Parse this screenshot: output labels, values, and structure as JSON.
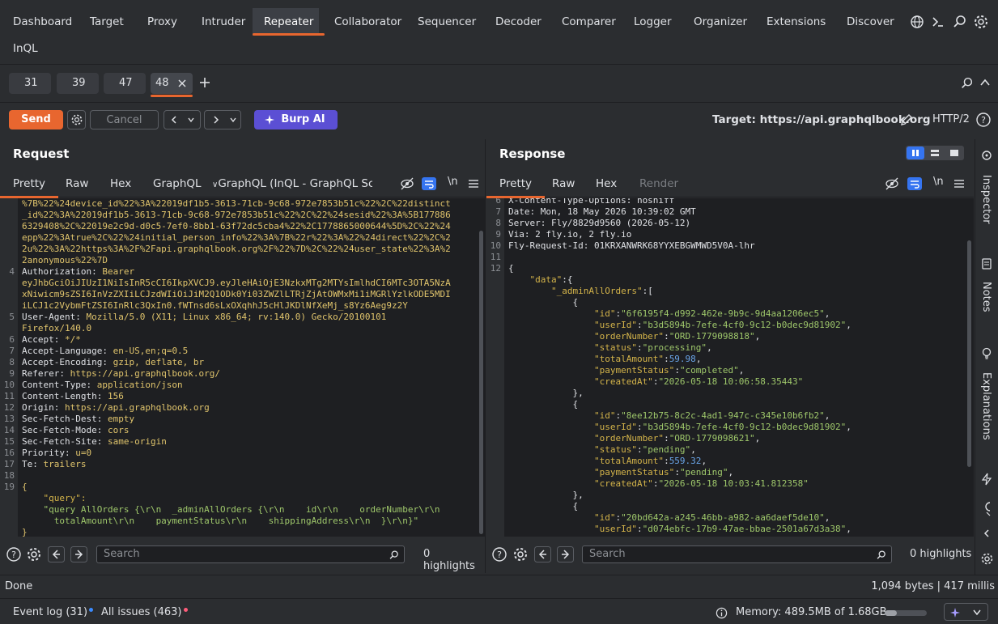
{
  "nav": {
    "tabs": [
      "Dashboard",
      "Target",
      "Proxy",
      "Intruder",
      "Repeater",
      "Collaborator",
      "Sequencer",
      "Decoder",
      "Comparer",
      "Logger",
      "Organizer",
      "Extensions",
      "Discover"
    ],
    "second_row": "InQL"
  },
  "repeater_tabs": [
    "31",
    "39",
    "47",
    "48"
  ],
  "toolbar": {
    "send": "Send",
    "cancel": "Cancel",
    "burp_ai": "Burp AI",
    "target": "Target: https://api.graphqlbook.org",
    "protocol": "HTTP/2"
  },
  "request": {
    "title": "Request",
    "tabs": [
      "Pretty",
      "Raw",
      "Hex",
      "GraphQL",
      "GraphQL (InQL - GraphQL Sc..."
    ],
    "newline_toggle": "\\n",
    "lines": [
      {
        "n": "",
        "t": "%7B%22%24device_id%22%3A%22019df1b5-3613-71cb-9c68-972e7853b51c%22%2C%22distinct"
      },
      {
        "n": "",
        "t": "_id%22%3A%22019df1b5-3613-71cb-9c68-972e7853b51c%22%2C%22%24sesid%22%3A%5B177886"
      },
      {
        "n": "",
        "t": "6329408%2C%22019e2c9d-d0c5-7ef0-8bb1-63f72dc5cba4%22%2C1778865000644%5D%2C%22%24"
      },
      {
        "n": "",
        "t": "epp%22%3Atrue%2C%22%24initial_person_info%22%3A%7B%22r%22%3A%22%24direct%22%2C%2"
      },
      {
        "n": "",
        "t": "2u%22%3A%22https%3A%2F%2Fapi.graphqlbook.org%2F%22%7D%2C%22%24user_state%22%3A%2"
      },
      {
        "n": "",
        "t": "2anonymous%22%7D"
      },
      {
        "n": "4",
        "k": "Authorization:",
        "v": " Bearer"
      },
      {
        "n": "",
        "v": "eyJhbGciOiJIUzI1NiIsInR5cCI6IkpXVCJ9.eyJleHAiOjE3NzkxMTg2MTYsImlhdCI6MTc3OTA5NzA"
      },
      {
        "n": "",
        "v": "xNiwicm9sZSI6InVzZXIiLCJzdWIiOiJiM2Q1ODk0Yi03ZWZlLTRjZjAtOWMxMi1iMGRlYzlkODE5MDI"
      },
      {
        "n": "",
        "v": "iLCJ1c2VybmFtZSI6InRlc3QxIn0.fWTnsd6sLxOXqhhJ5cHlJKDlNfXeMj_s8Yz6Aeg9z2Y"
      },
      {
        "n": "5",
        "k": "User-Agent:",
        "v": " Mozilla/5.0 (X11; Linux x86_64; rv:140.0) Gecko/20100101"
      },
      {
        "n": "",
        "v": "Firefox/140.0"
      },
      {
        "n": "6",
        "k": "Accept:",
        "v": " */*"
      },
      {
        "n": "7",
        "k": "Accept-Language:",
        "v": " en-US,en;q=0.5"
      },
      {
        "n": "8",
        "k": "Accept-Encoding:",
        "v": " gzip, deflate, br"
      },
      {
        "n": "9",
        "k": "Referer:",
        "v": " https://api.graphqlbook.org/"
      },
      {
        "n": "10",
        "k": "Content-Type:",
        "v": " application/json"
      },
      {
        "n": "11",
        "k": "Content-Length:",
        "v": " 156"
      },
      {
        "n": "12",
        "k": "Origin:",
        "v": " https://api.graphqlbook.org"
      },
      {
        "n": "13",
        "k": "Sec-Fetch-Dest:",
        "v": " empty"
      },
      {
        "n": "14",
        "k": "Sec-Fetch-Mode:",
        "v": " cors"
      },
      {
        "n": "15",
        "k": "Sec-Fetch-Site:",
        "v": " same-origin"
      },
      {
        "n": "16",
        "k": "Priority:",
        "v": " u=0"
      },
      {
        "n": "17",
        "k": "Te:",
        "v": " trailers"
      },
      {
        "n": "18",
        "v": ""
      },
      {
        "n": "19",
        "v": "{"
      },
      {
        "n": "",
        "o": "    \"query\":"
      },
      {
        "n": "",
        "g": "    \"query AllOrders {\\r\\n  _adminAllOrders {\\r\\n    id\\r\\n    orderNumber\\r\\n"
      },
      {
        "n": "",
        "g": "      totalAmount\\r\\n    paymentStatus\\r\\n    shippingAddress\\r\\n  }\\r\\n}\""
      },
      {
        "n": "",
        "v": "}"
      }
    ],
    "search_placeholder": "Search",
    "highlights": "0 highlights"
  },
  "response": {
    "title": "Response",
    "tabs": [
      "Pretty",
      "Raw",
      "Hex",
      "Render"
    ],
    "newline_toggle": "\\n",
    "lines": [
      {
        "n": "6",
        "t": "X-Content-Type-Options: nosniff"
      },
      {
        "n": "7",
        "t": "Date: Mon, 18 May 2026 10:39:02 GMT"
      },
      {
        "n": "8",
        "t": "Server: Fly/8829d9560 (2026-05-12)"
      },
      {
        "n": "9",
        "t": "Via: 2 fly.io, 2 fly.io"
      },
      {
        "n": "10",
        "t": "Fly-Request-Id: 01KRXANWRK68YYXEBGWMWD5V0A-lhr"
      },
      {
        "n": "11",
        "t": ""
      },
      {
        "n": "12",
        "t": "{"
      },
      {
        "n": "",
        "o": "    \"data\"",
        "t": ":{"
      },
      {
        "n": "",
        "o": "        \"_adminAllOrders\"",
        "t": ":["
      },
      {
        "n": "",
        "t": "            {"
      },
      {
        "n": "",
        "o": "                \"id\"",
        "t": ":",
        "g": "\"6f6195f4-d992-462e-9b9c-9d4aa1206ec5\"",
        "e": ","
      },
      {
        "n": "",
        "o": "                \"userId\"",
        "t": ":",
        "g": "\"b3d5894b-7efe-4cf0-9c12-b0dec9d81902\"",
        "e": ","
      },
      {
        "n": "",
        "o": "                \"orderNumber\"",
        "t": ":",
        "g": "\"ORD-1779098818\"",
        "e": ","
      },
      {
        "n": "",
        "o": "                \"status\"",
        "t": ":",
        "g": "\"processing\"",
        "e": ","
      },
      {
        "n": "",
        "o": "                \"totalAmount\"",
        "t": ":",
        "b": "59.98",
        "e": ","
      },
      {
        "n": "",
        "o": "                \"paymentStatus\"",
        "t": ":",
        "g": "\"completed\"",
        "e": ","
      },
      {
        "n": "",
        "o": "                \"createdAt\"",
        "t": ":",
        "g": "\"2026-05-18 10:06:58.35443\""
      },
      {
        "n": "",
        "t": "            },"
      },
      {
        "n": "",
        "t": "            {"
      },
      {
        "n": "",
        "o": "                \"id\"",
        "t": ":",
        "g": "\"8ee12b75-8c2c-4ad1-947c-c345e10b6fb2\"",
        "e": ","
      },
      {
        "n": "",
        "o": "                \"userId\"",
        "t": ":",
        "g": "\"b3d5894b-7efe-4cf0-9c12-b0dec9d81902\"",
        "e": ","
      },
      {
        "n": "",
        "o": "                \"orderNumber\"",
        "t": ":",
        "g": "\"ORD-1779098621\"",
        "e": ","
      },
      {
        "n": "",
        "o": "                \"status\"",
        "t": ":",
        "g": "\"pending\"",
        "e": ","
      },
      {
        "n": "",
        "o": "                \"totalAmount\"",
        "t": ":",
        "b": "559.32",
        "e": ","
      },
      {
        "n": "",
        "o": "                \"paymentStatus\"",
        "t": ":",
        "g": "\"pending\"",
        "e": ","
      },
      {
        "n": "",
        "o": "                \"createdAt\"",
        "t": ":",
        "g": "\"2026-05-18 10:03:41.812358\""
      },
      {
        "n": "",
        "t": "            },"
      },
      {
        "n": "",
        "t": "            {"
      },
      {
        "n": "",
        "o": "                \"id\"",
        "t": ":",
        "g": "\"20bd642a-a245-46bb-a982-aa6daef5de10\"",
        "e": ","
      },
      {
        "n": "",
        "o": "                \"userId\"",
        "t": ":",
        "g": "\"d074ebfc-17b9-47ae-bbae-2501a67d3a38\"",
        "e": ","
      }
    ],
    "search_placeholder": "Search",
    "highlights": "0 highlights"
  },
  "sidebar": [
    "Inspector",
    "Notes",
    "Explanations"
  ],
  "status": {
    "left": "Done",
    "right": "1,094 bytes | 417 millis"
  },
  "bottom": {
    "event_log": "Event log (31)",
    "all_issues": "All issues (463)",
    "memory": "Memory: 489.5MB of 1.68GB",
    "memory_fraction": 0.29
  },
  "colors": {
    "accent": "#e8662f",
    "ai": "#5b4fd4",
    "event_dot": "#3b8bff",
    "issue_dot": "#ff5c7a"
  }
}
